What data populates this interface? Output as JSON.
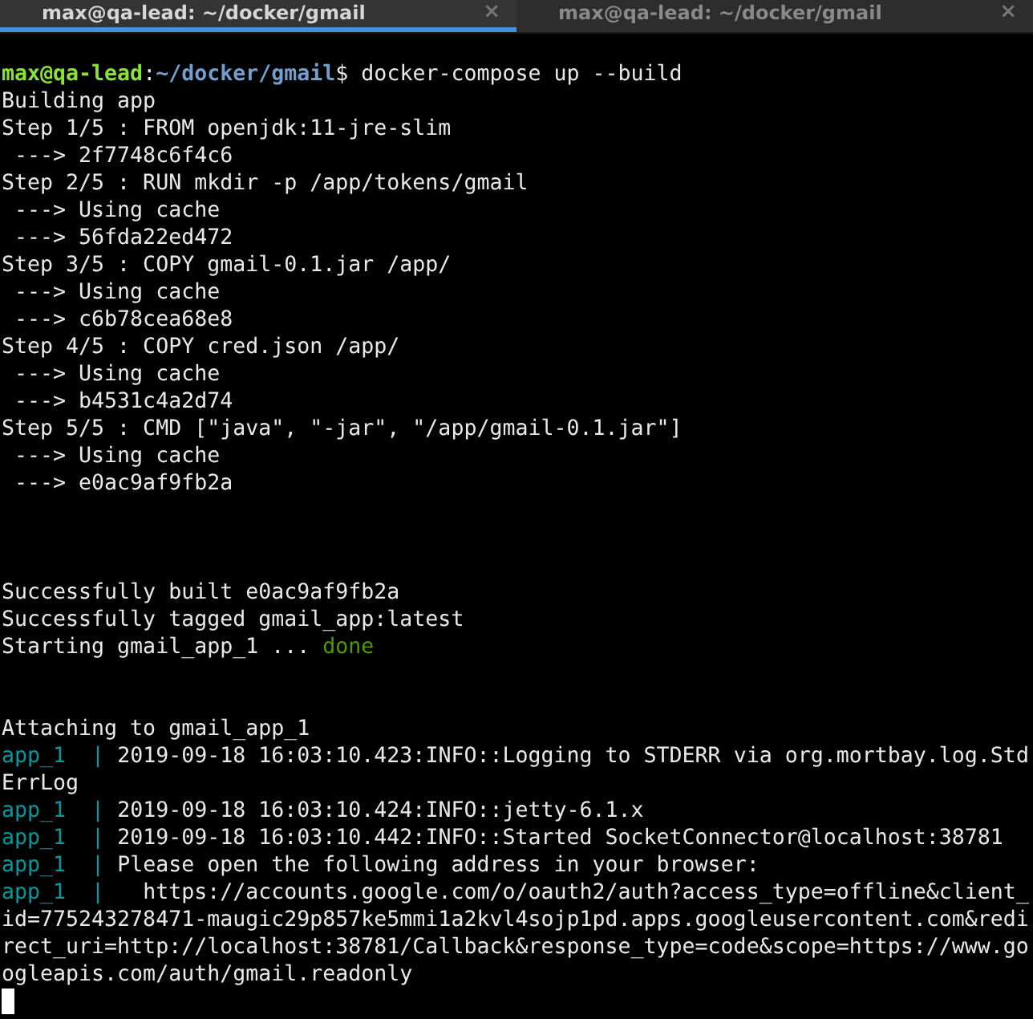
{
  "tabs": [
    {
      "label": "max@qa-lead: ~/docker/gmail",
      "close": "×",
      "selected": true
    },
    {
      "label": "max@qa-lead: ~/docker/gmail",
      "close": "×",
      "selected": false
    }
  ],
  "terminal": {
    "lines": [
      {
        "kind": "prompt",
        "user_host": "max@qa-lead",
        "separator": ":",
        "path": "~/docker/gmail",
        "symbol": "$",
        "command": "docker-compose up --build"
      },
      {
        "kind": "text",
        "text": "Building app"
      },
      {
        "kind": "text",
        "text": "Step 1/5 : FROM openjdk:11-jre-slim"
      },
      {
        "kind": "text",
        "text": " ---> 2f7748c6f4c6"
      },
      {
        "kind": "text",
        "text": "Step 2/5 : RUN mkdir -p /app/tokens/gmail"
      },
      {
        "kind": "text",
        "text": " ---> Using cache"
      },
      {
        "kind": "text",
        "text": " ---> 56fda22ed472"
      },
      {
        "kind": "text",
        "text": "Step 3/5 : COPY gmail-0.1.jar /app/"
      },
      {
        "kind": "text",
        "text": " ---> Using cache"
      },
      {
        "kind": "text",
        "text": " ---> c6b78cea68e8"
      },
      {
        "kind": "text",
        "text": "Step 4/5 : COPY cred.json /app/"
      },
      {
        "kind": "text",
        "text": " ---> Using cache"
      },
      {
        "kind": "text",
        "text": " ---> b4531c4a2d74"
      },
      {
        "kind": "text",
        "text": "Step 5/5 : CMD [\"java\", \"-jar\", \"/app/gmail-0.1.jar\"]"
      },
      {
        "kind": "text",
        "text": " ---> Using cache"
      },
      {
        "kind": "text",
        "text": " ---> e0ac9af9fb2a"
      },
      {
        "kind": "blank"
      },
      {
        "kind": "blank"
      },
      {
        "kind": "blank"
      },
      {
        "kind": "text",
        "text": "Successfully built e0ac9af9fb2a"
      },
      {
        "kind": "text",
        "text": "Successfully tagged gmail_app:latest"
      },
      {
        "kind": "status",
        "text": "Starting gmail_app_1 ... ",
        "status": "done"
      },
      {
        "kind": "blank"
      },
      {
        "kind": "blank"
      },
      {
        "kind": "text",
        "text": "Attaching to gmail_app_1"
      },
      {
        "kind": "log",
        "service": "app_1  | ",
        "text": "2019-09-18 16:03:10.423:INFO::Logging to STDERR via org.mortbay.log.Std"
      },
      {
        "kind": "text",
        "text": "ErrLog"
      },
      {
        "kind": "log",
        "service": "app_1  | ",
        "text": "2019-09-18 16:03:10.424:INFO::jetty-6.1.x"
      },
      {
        "kind": "log",
        "service": "app_1  | ",
        "text": "2019-09-18 16:03:10.442:INFO::Started SocketConnector@localhost:38781"
      },
      {
        "kind": "log",
        "service": "app_1  | ",
        "text": "Please open the following address in your browser:"
      },
      {
        "kind": "log",
        "service": "app_1  | ",
        "text": "  https://accounts.google.com/o/oauth2/auth?access_type=offline&client_"
      },
      {
        "kind": "text",
        "text": "id=775243278471-maugic29p857ke5mmi1a2kvl4sojp1pd.apps.googleusercontent.com&redi"
      },
      {
        "kind": "text",
        "text": "rect_uri=http://localhost:38781/Callback&response_type=code&scope=https://www.go"
      },
      {
        "kind": "text",
        "text": "ogleapis.com/auth/gmail.readonly"
      },
      {
        "kind": "cursor"
      }
    ]
  }
}
